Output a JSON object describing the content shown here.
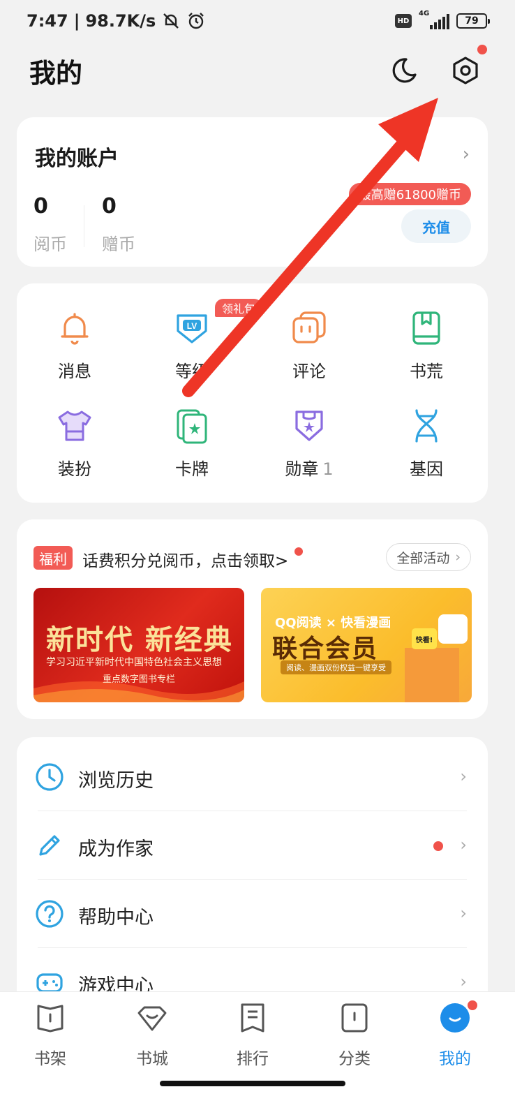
{
  "status_bar": {
    "time": "7:47",
    "speed": "98.7K/s",
    "hd": "HD",
    "network": "4G",
    "battery": "79"
  },
  "header": {
    "title": "我的"
  },
  "account": {
    "title": "我的账户",
    "read_coins": "0",
    "read_coins_label": "阅币",
    "gift_coins": "0",
    "gift_coins_label": "赠币",
    "promo": "最高赠61800赠币",
    "recharge": "充值"
  },
  "grid": {
    "gift_tag": "领礼包",
    "items": [
      {
        "label": "消息",
        "icon": "bell-icon"
      },
      {
        "label": "等级",
        "icon": "level-badge-icon"
      },
      {
        "label": "评论",
        "icon": "comment-icon"
      },
      {
        "label": "书荒",
        "icon": "bookmark-book-icon"
      },
      {
        "label": "装扮",
        "icon": "tshirt-icon"
      },
      {
        "label": "卡牌",
        "icon": "cards-icon"
      },
      {
        "label": "勋章",
        "icon": "medal-icon",
        "count": "1"
      },
      {
        "label": "基因",
        "icon": "dna-icon"
      }
    ]
  },
  "welfare": {
    "tag": "福利",
    "text": "话费积分兑阅币，点击领取>",
    "all_activities": "全部活动",
    "banner1": {
      "title": "新时代  新经典",
      "line1": "学习习近平新时代中国特色社会主义思想",
      "line2": "重点数字图书专栏"
    },
    "banner2": {
      "top": "QQ阅读 × 快看漫画",
      "title": "联合会员",
      "sub": "阅读、漫画双份权益一键享受",
      "badge": "快看!"
    }
  },
  "list": [
    {
      "label": "浏览历史",
      "icon": "clock-icon"
    },
    {
      "label": "成为作家",
      "icon": "pencil-icon"
    },
    {
      "label": "帮助中心",
      "icon": "help-icon"
    },
    {
      "label": "游戏中心",
      "icon": "gamepad-icon"
    }
  ],
  "nav": [
    {
      "label": "书架",
      "icon": "bookshelf-icon"
    },
    {
      "label": "书城",
      "icon": "bookstore-icon"
    },
    {
      "label": "排行",
      "icon": "ranking-icon"
    },
    {
      "label": "分类",
      "icon": "category-icon"
    },
    {
      "label": "我的",
      "icon": "profile-icon"
    }
  ],
  "colors": {
    "accent": "#1d8de9",
    "badge_red": "#f25b55",
    "arrow_red": "#ee3526"
  }
}
